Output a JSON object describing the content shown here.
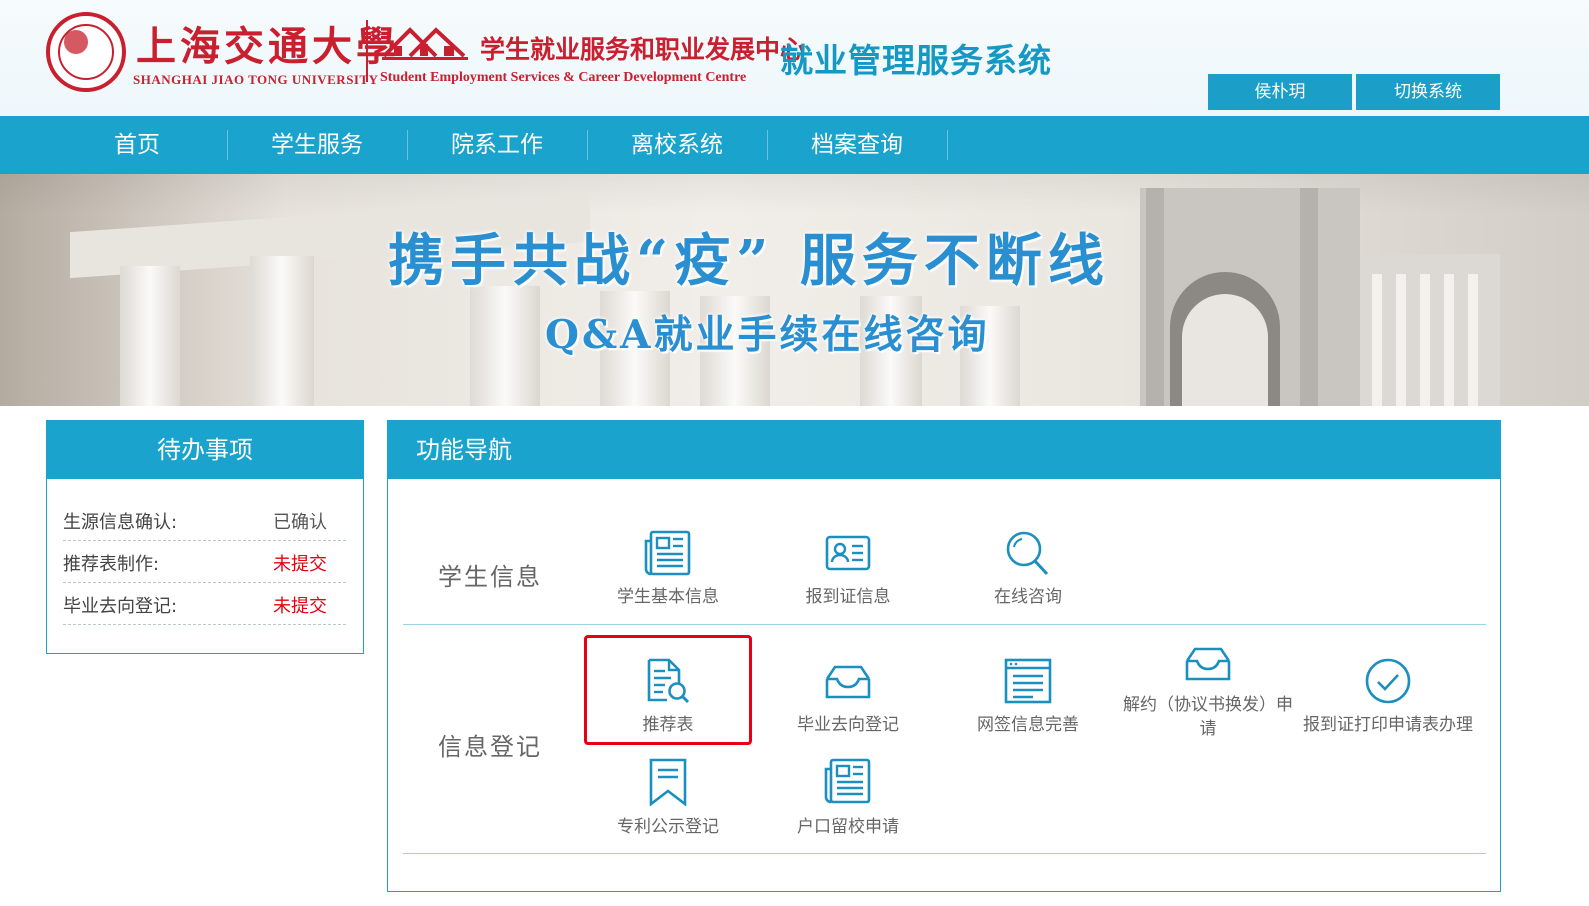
{
  "header": {
    "university_cn": "上海交通大學",
    "university_en": "SHANGHAI JIAO TONG UNIVERSITY",
    "center_cn": "学生就业服务和职业发展中心",
    "center_en": "Student Employment Services & Career Development Centre",
    "system_title": "就业管理服务系统",
    "user_button": "侯朴玥",
    "switch_button": "切换系统",
    "brand_color": "#c8202f",
    "accent_color": "#1aa3cc"
  },
  "nav": {
    "items": [
      {
        "label": "首页"
      },
      {
        "label": "学生服务"
      },
      {
        "label": "院系工作"
      },
      {
        "label": "离校系统"
      },
      {
        "label": "档案查询"
      }
    ]
  },
  "banner": {
    "line1": "携手共战“疫” 服务不断线",
    "line2": "Q&A就业手续在线咨询"
  },
  "todo": {
    "title": "待办事项",
    "rows": [
      {
        "label": "生源信息确认:",
        "value": "已确认",
        "status": "done"
      },
      {
        "label": "推荐表制作:",
        "value": "未提交",
        "status": "pending"
      },
      {
        "label": "毕业去向登记:",
        "value": "未提交",
        "status": "pending"
      }
    ],
    "pending_color": "#e60012"
  },
  "functions": {
    "title": "功能导航",
    "sections": [
      {
        "title": "学生信息",
        "items": [
          {
            "label": "学生基本信息",
            "icon": "newspaper-icon"
          },
          {
            "label": "报到证信息",
            "icon": "id-card-icon"
          },
          {
            "label": "在线咨询",
            "icon": "magnifier-icon"
          }
        ]
      },
      {
        "title": "信息登记",
        "items": [
          {
            "label": "推荐表",
            "icon": "document-search-icon",
            "highlighted": true
          },
          {
            "label": "毕业去向登记",
            "icon": "inbox-tray-icon"
          },
          {
            "label": "网签信息完善",
            "icon": "web-page-icon"
          },
          {
            "label": "解约（协议书换发）申请",
            "icon": "inbox-tray-icon"
          },
          {
            "label": "报到证打印申请表办理",
            "icon": "check-circle-icon"
          },
          {
            "label": "专利公示登记",
            "icon": "bookmark-icon"
          },
          {
            "label": "户口留校申请",
            "icon": "newspaper-icon"
          }
        ]
      }
    ]
  }
}
